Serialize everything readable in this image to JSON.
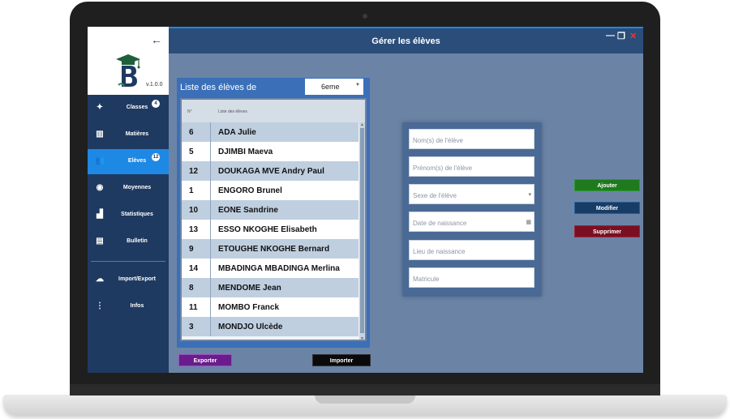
{
  "app": {
    "title": "Gérer les élèves",
    "version": "v.1.0.0"
  },
  "window_controls": {
    "minimize": "—",
    "restore": "❐",
    "close": "✕"
  },
  "sidebar": {
    "back_icon": "←",
    "items": [
      {
        "label": "Classes",
        "icon": "classes-icon",
        "glyph": "✦",
        "badge": "4"
      },
      {
        "label": "Matières",
        "icon": "book-icon",
        "glyph": "▥",
        "badge": ""
      },
      {
        "label": "Elèves",
        "icon": "students-icon",
        "glyph": "👥",
        "badge": "12"
      },
      {
        "label": "Moyennes",
        "icon": "average-icon",
        "glyph": "◉",
        "badge": ""
      },
      {
        "label": "Statistiques",
        "icon": "chart-icon",
        "glyph": "▟",
        "badge": ""
      },
      {
        "label": "Bulletin",
        "icon": "report-icon",
        "glyph": "▤",
        "badge": ""
      },
      {
        "label": "Import/Export",
        "icon": "cloud-icon",
        "glyph": "☁",
        "badge": ""
      },
      {
        "label": "Infos",
        "icon": "more-vertical-icon",
        "glyph": "⋮",
        "badge": ""
      }
    ]
  },
  "list": {
    "header_label": "Liste des élèves de",
    "selected_class": "6eme",
    "columns": {
      "number": "N°",
      "name": "Liste des élèves"
    },
    "rows": [
      {
        "number": "6",
        "name": "ADA Julie"
      },
      {
        "number": "5",
        "name": "DJIMBI Maeva"
      },
      {
        "number": "12",
        "name": "DOUKAGA MVE Andry Paul"
      },
      {
        "number": "1",
        "name": "ENGORO Brunel"
      },
      {
        "number": "10",
        "name": "EONE Sandrine"
      },
      {
        "number": "13",
        "name": "ESSO NKOGHE Elisabeth"
      },
      {
        "number": "9",
        "name": "ETOUGHE NKOGHE Bernard"
      },
      {
        "number": "14",
        "name": "MBADINGA MBADINGA Merlina"
      },
      {
        "number": "8",
        "name": "MENDOME Jean"
      },
      {
        "number": "11",
        "name": "MOMBO  Franck"
      },
      {
        "number": "3",
        "name": "MONDJO Ulcède"
      }
    ],
    "export_label": "Exporter",
    "import_label": "Importer"
  },
  "form": {
    "last_name_placeholder": "Nom(s) de l'élève",
    "first_name_placeholder": "Prénom(s) de l'élève",
    "sex_placeholder": "Sexe de l'élève",
    "birth_date_placeholder": "Date de naissance",
    "birth_place_placeholder": "Lieu de naissance",
    "registration_placeholder": "Matricule"
  },
  "actions": {
    "add_label": "Ajouter",
    "edit_label": "Modifier",
    "delete_label": "Supprimer"
  },
  "colors": {
    "sidebar": "#1f3a61",
    "active": "#1e88e5",
    "titlebar": "#2b4d7a",
    "content": "#6b84a6",
    "add": "#1f7a1f",
    "edit": "#173c66",
    "delete": "#7a0f22",
    "export": "#6a1b8c"
  }
}
